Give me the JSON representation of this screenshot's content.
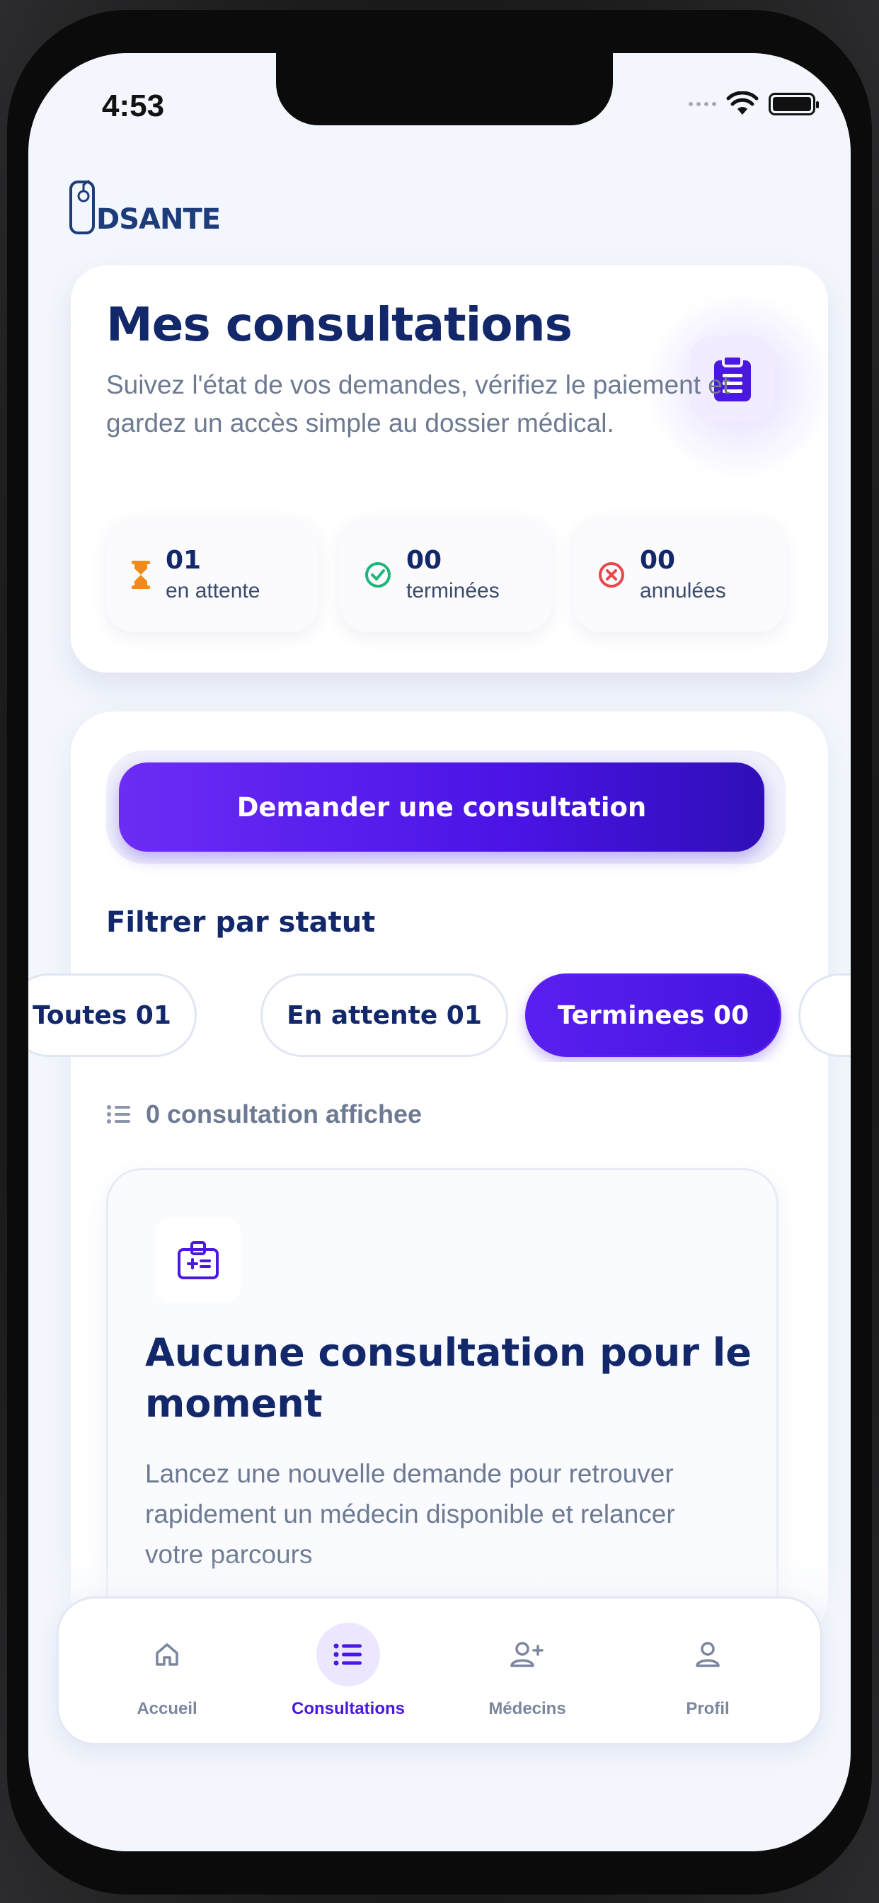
{
  "status_bar": {
    "time": "4:53"
  },
  "brand": {
    "logo_text": "DSANTE"
  },
  "header": {
    "title": "Mes consultations",
    "subtitle": "Suivez l'état de vos demandes, vérifiez le paiement et gardez un accès simple au dossier médical."
  },
  "stats": [
    {
      "value": "01",
      "label": "en attente",
      "icon": "hourglass-icon",
      "color": "#f08a1c"
    },
    {
      "value": "00",
      "label": "terminées",
      "icon": "check-circle-icon",
      "color": "#1fb57a"
    },
    {
      "value": "00",
      "label": "annulées",
      "icon": "x-circle-icon",
      "color": "#e5484d"
    }
  ],
  "cta": {
    "label": "Demander une consultation"
  },
  "filters": {
    "title": "Filtrer par statut",
    "chips": [
      {
        "label": "Toutes 01",
        "active": false
      },
      {
        "label": "En attente 01",
        "active": false
      },
      {
        "label": "Terminees 00",
        "active": true
      }
    ]
  },
  "results": {
    "count_text": "0 consultation affichee"
  },
  "empty_state": {
    "title": "Aucune consultation pour le moment",
    "text": "Lancez une nouvelle demande pour retrouver rapidement un médecin disponible et relancer votre parcours"
  },
  "tabbar": {
    "tabs": [
      {
        "label": "Accueil",
        "icon": "home-icon",
        "active": false
      },
      {
        "label": "Consultations",
        "icon": "list-icon",
        "active": true
      },
      {
        "label": "Médecins",
        "icon": "user-plus-icon",
        "active": false
      },
      {
        "label": "Profil",
        "icon": "user-icon",
        "active": false
      }
    ]
  },
  "colors": {
    "accent": "#4a18e0",
    "navy": "#13286b",
    "muted": "#6d7a92"
  }
}
